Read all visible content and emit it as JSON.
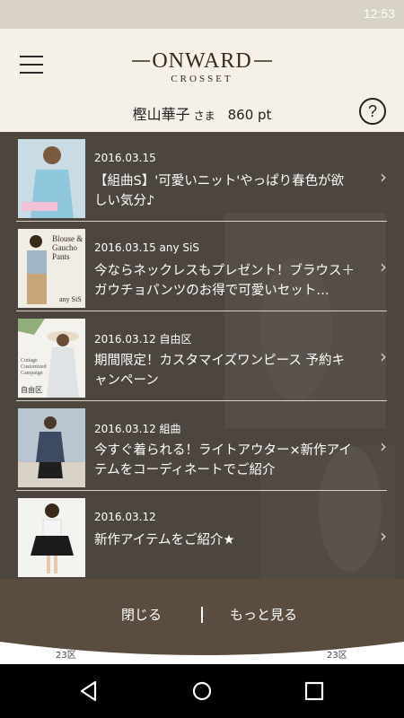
{
  "status_bar": {
    "time": "12:53"
  },
  "header": {
    "brand": "ONWARD",
    "brand_sub": "CROSSET",
    "user_name": "樫山華子",
    "honorific": "さま",
    "points": "860 pt",
    "help_label": "?"
  },
  "news": [
    {
      "date": "2016.03.15",
      "title": "【組曲S】'可愛いニット'やっぱり春色が欲しい気分♪",
      "thumb_text": ""
    },
    {
      "date": "2016.03.15 any SiS",
      "title": "今ならネックレスもプレゼント！ブラウス＋ガウチョパンツのお得で可愛いセット…",
      "thumb_text": "Blouse & Gaucho Pants",
      "thumb_brand": "any SiS"
    },
    {
      "date": "2016.03.12 自由区",
      "title": "期間限定！カスタマイズワンピース 予約キャンペーン",
      "thumb_text": "Cottage Customized Campaign",
      "thumb_brand": "自由区"
    },
    {
      "date": "2016.03.12 組曲",
      "title": "今すぐ着られる！ライトアウター×新作アイテムをコーディネートでご紹介",
      "thumb_text": ""
    },
    {
      "date": "2016.03.12",
      "title": "新作アイテムをご紹介★",
      "thumb_text": ""
    }
  ],
  "footer": {
    "close_label": "閉じる",
    "more_label": "もっと見る",
    "peek_left": "23区",
    "peek_right": "23区"
  },
  "colors": {
    "header_bg": "#f5f1e8",
    "list_bg": "#4c463f",
    "footer_bg": "#5a4d3f",
    "accent": "#3a2a1a"
  },
  "icons": {
    "menu": "hamburger-icon",
    "help": "question-circle-icon",
    "chevron": "chevron-right-icon",
    "nav_back": "triangle-back-icon",
    "nav_home": "circle-home-icon",
    "nav_recents": "square-recents-icon"
  }
}
